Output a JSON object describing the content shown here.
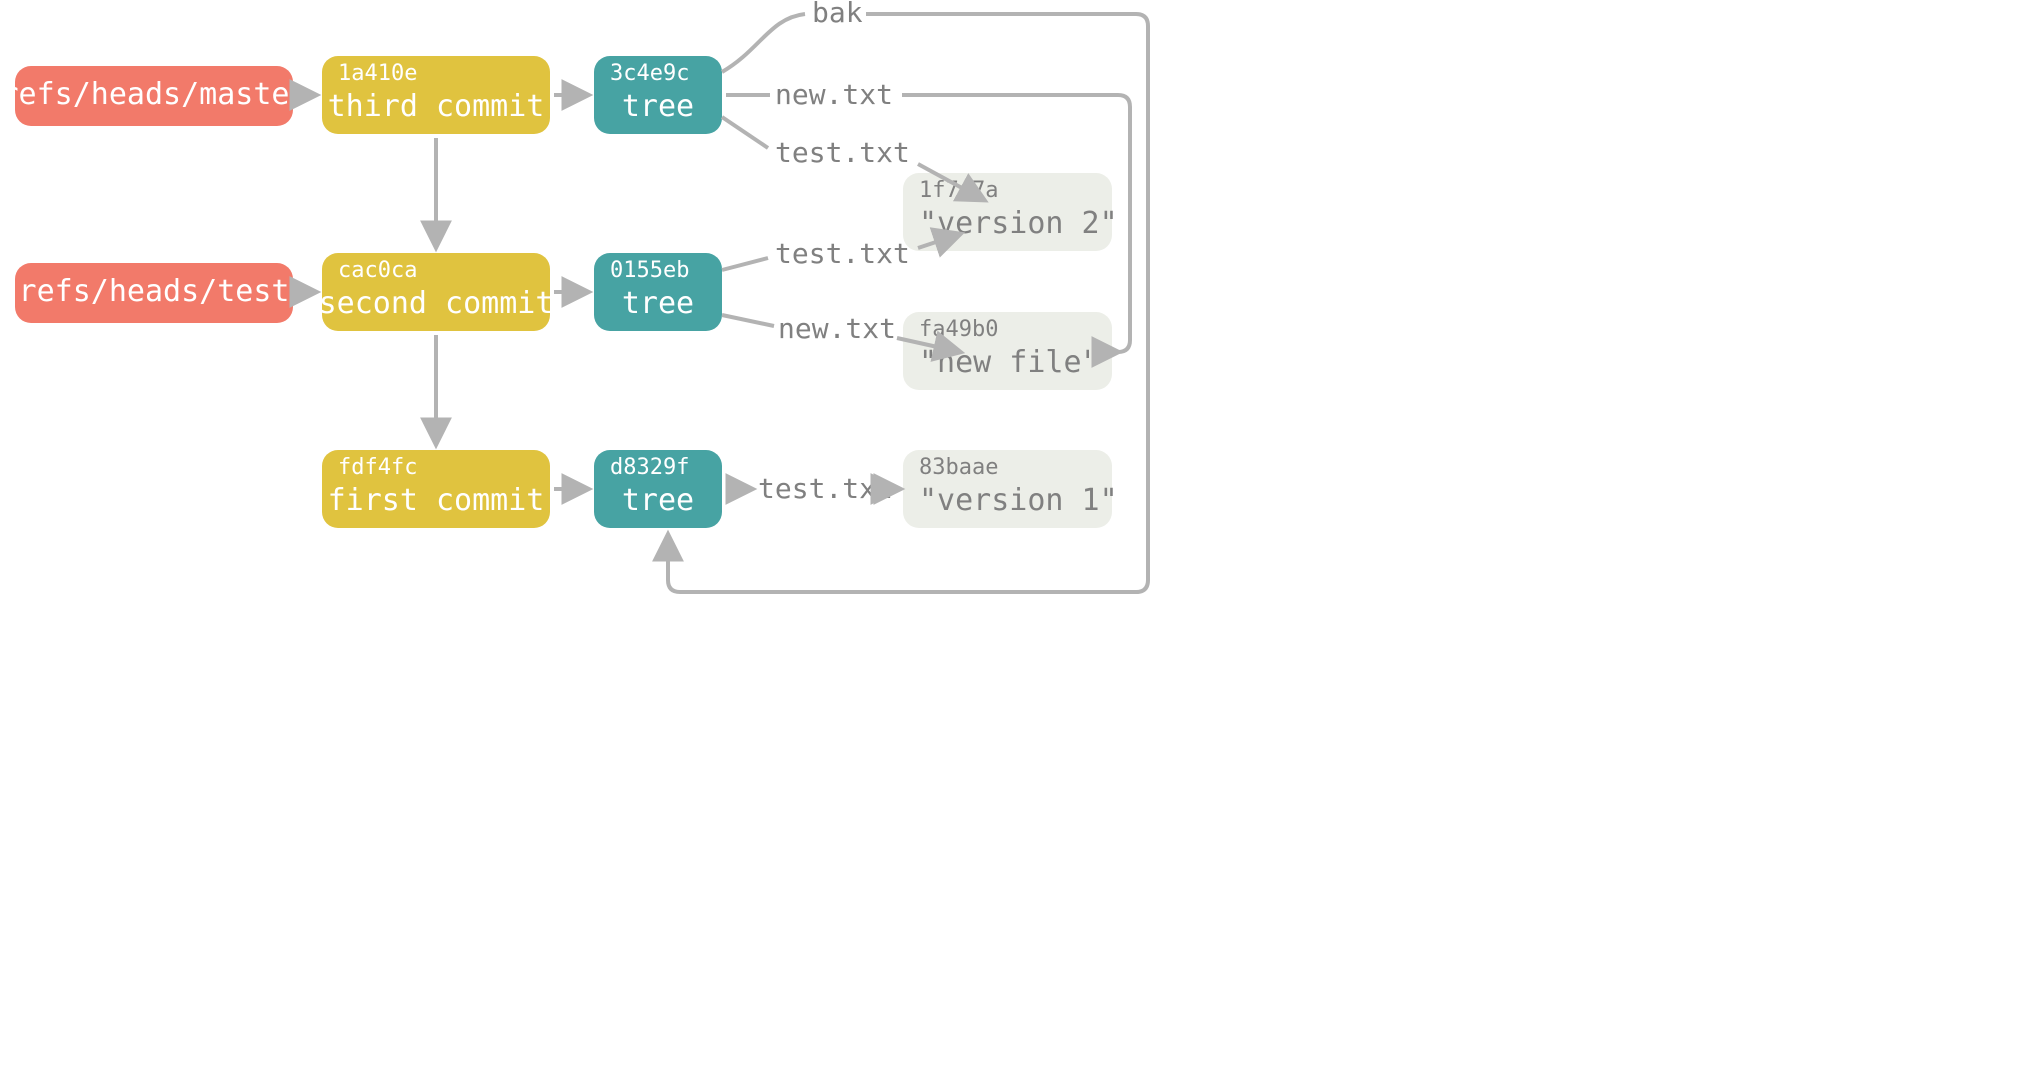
{
  "colors": {
    "ref": "#f27a6a",
    "commit": "#e0c33f",
    "tree": "#47a3a3",
    "blob": "#eceee8",
    "arrow": "#b3b3b3",
    "text_gray": "#808080"
  },
  "refs": {
    "master": {
      "label": "refs/heads/master"
    },
    "test": {
      "label": "refs/heads/test"
    }
  },
  "commits": {
    "third": {
      "hash": "1a410e",
      "label": "third commit"
    },
    "second": {
      "hash": "cac0ca",
      "label": "second commit"
    },
    "first": {
      "hash": "fdf4fc",
      "label": "first commit"
    }
  },
  "trees": {
    "t3": {
      "hash": "3c4e9c",
      "label": "tree"
    },
    "t2": {
      "hash": "0155eb",
      "label": "tree"
    },
    "t1": {
      "hash": "d8329f",
      "label": "tree"
    }
  },
  "blobs": {
    "v2": {
      "hash": "1f7a7a",
      "label": "\"version 2\""
    },
    "newfile": {
      "hash": "fa49b0",
      "label": "\"new file\""
    },
    "v1": {
      "hash": "83baae",
      "label": "\"version 1\""
    }
  },
  "edge_labels": {
    "bak": "bak",
    "t3_new": "new.txt",
    "t3_test": "test.txt",
    "t2_test": "test.txt",
    "t2_new": "new.txt",
    "t1_test": "test.txt"
  }
}
